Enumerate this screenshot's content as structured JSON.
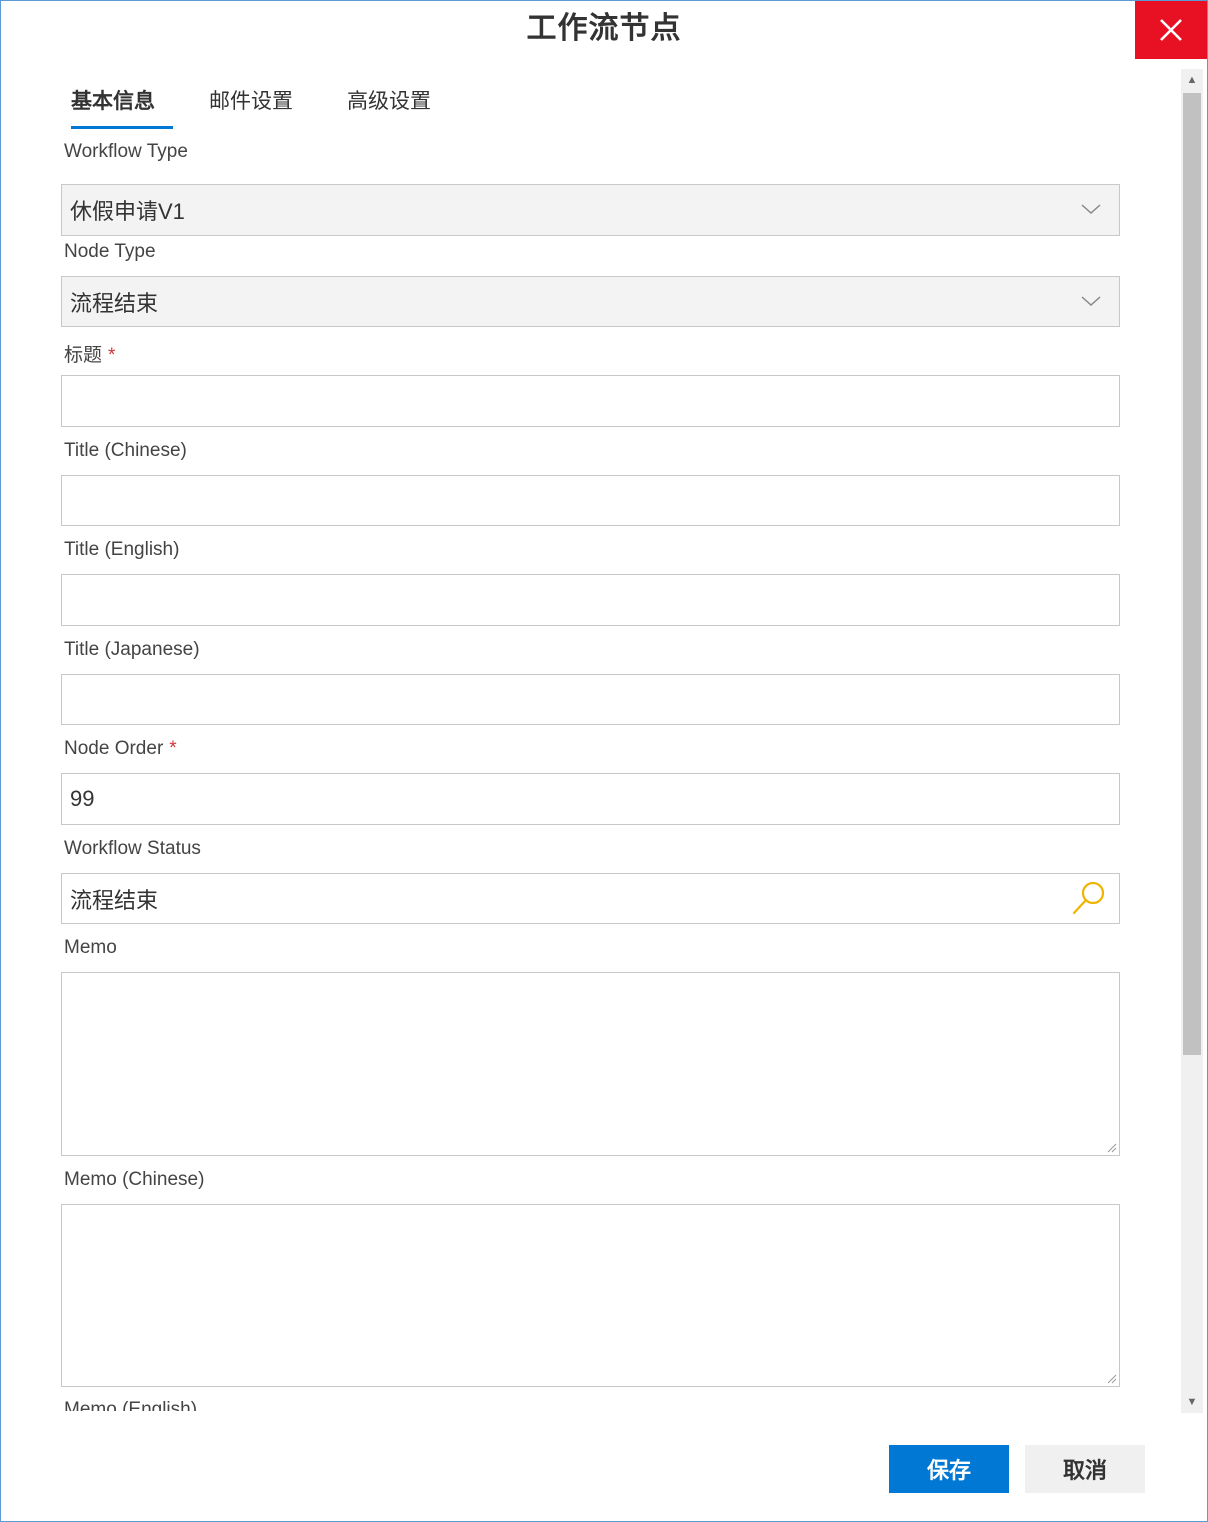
{
  "dialog": {
    "title": "工作流节点"
  },
  "tabs": [
    {
      "label": "基本信息"
    },
    {
      "label": "邮件设置"
    },
    {
      "label": "高级设置"
    }
  ],
  "fields": {
    "workflow_type": {
      "label": "Workflow Type",
      "value": "休假申请V1"
    },
    "node_type": {
      "label": "Node Type",
      "value": "流程结束"
    },
    "title": {
      "label": "标题",
      "required": "*",
      "value": ""
    },
    "title_chinese": {
      "label": "Title (Chinese)",
      "value": ""
    },
    "title_english": {
      "label": "Title (English)",
      "value": ""
    },
    "title_japanese": {
      "label": "Title (Japanese)",
      "value": ""
    },
    "node_order": {
      "label": "Node Order",
      "required": "*",
      "value": "99"
    },
    "workflow_status": {
      "label": "Workflow Status",
      "value": "流程结束"
    },
    "memo": {
      "label": "Memo",
      "value": ""
    },
    "memo_chinese": {
      "label": "Memo (Chinese)",
      "value": ""
    },
    "memo_english": {
      "label": "Memo (English)"
    }
  },
  "footer": {
    "save_label": "保存",
    "cancel_label": "取消"
  },
  "colors": {
    "accent": "#0078d4",
    "close": "#e81123",
    "required": "#d13438",
    "lookup_icon": "#f0b400"
  }
}
